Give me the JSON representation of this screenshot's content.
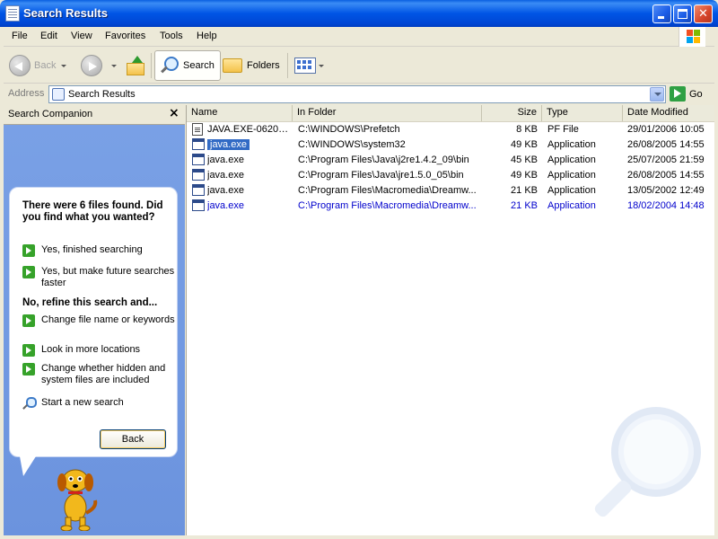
{
  "window": {
    "title": "Search Results"
  },
  "menu": [
    "File",
    "Edit",
    "View",
    "Favorites",
    "Tools",
    "Help"
  ],
  "toolbar": {
    "back_label": "Back",
    "search_label": "Search",
    "folders_label": "Folders"
  },
  "address": {
    "label": "Address",
    "value": "Search Results",
    "go_label": "Go"
  },
  "companion": {
    "title": "Search Companion",
    "close_glyph": "×",
    "found_text": "There were 6 files found. Did you find what you wanted?",
    "options_found": [
      "Yes, finished searching",
      "Yes, but make future searches faster"
    ],
    "refine_heading": "No, refine this search and...",
    "options_refine": [
      "Change file name or keywords",
      "Look in more locations",
      "Change whether hidden and system files are included"
    ],
    "new_search": "Start a new search",
    "back_button": "Back"
  },
  "results": {
    "columns": [
      "Name",
      "In Folder",
      "Size",
      "Type",
      "Date Modified"
    ],
    "rows": [
      {
        "name": "JAVA.EXE-06201...",
        "folder": "C:\\WINDOWS\\Prefetch",
        "size": "8 KB",
        "type": "PF File",
        "date": "29/01/2006 10:05",
        "icon": "pf-file-icon"
      },
      {
        "name": "java.exe",
        "folder": "C:\\WINDOWS\\system32",
        "size": "49 KB",
        "type": "Application",
        "date": "26/08/2005 14:55",
        "icon": "application-icon",
        "selected": true
      },
      {
        "name": "java.exe",
        "folder": "C:\\Program Files\\Java\\j2re1.4.2_09\\bin",
        "size": "45 KB",
        "type": "Application",
        "date": "25/07/2005 21:59",
        "icon": "application-icon"
      },
      {
        "name": "java.exe",
        "folder": "C:\\Program Files\\Java\\jre1.5.0_05\\bin",
        "size": "49 KB",
        "type": "Application",
        "date": "26/08/2005 14:55",
        "icon": "application-icon"
      },
      {
        "name": "java.exe",
        "folder": "C:\\Program Files\\Macromedia\\Dreamw...",
        "size": "21 KB",
        "type": "Application",
        "date": "13/05/2002 12:49",
        "icon": "application-icon"
      },
      {
        "name": "java.exe",
        "folder": "C:\\Program Files\\Macromedia\\Dreamw...",
        "size": "21 KB",
        "type": "Application",
        "date": "18/02/2004 14:48",
        "icon": "application-icon",
        "highlight": true
      }
    ]
  },
  "colors": {
    "titlebar": "#0055e5",
    "selection": "#316ac5",
    "companion_bg": "#6b93de",
    "highlight_text": "#0000cc"
  }
}
